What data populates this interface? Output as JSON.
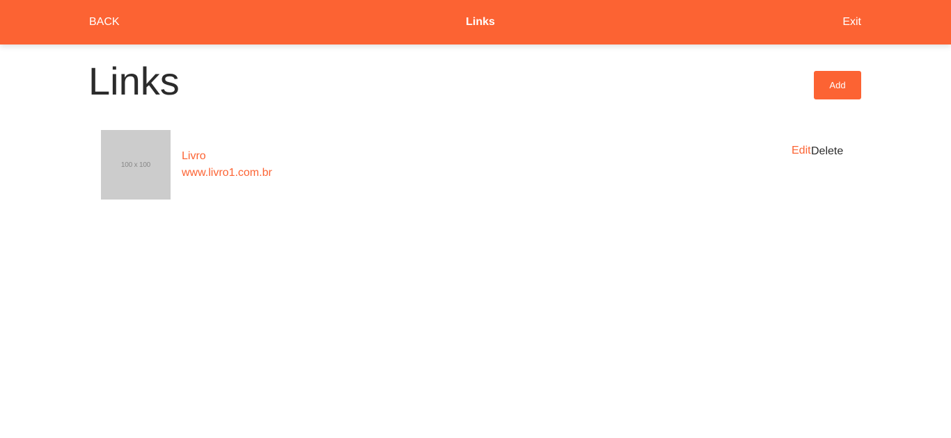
{
  "header": {
    "back_label": "BACK",
    "title": "Links",
    "exit_label": "Exit"
  },
  "main": {
    "title": "Links",
    "add_label": "Add",
    "links": [
      {
        "thumbnail_text": "100 x 100",
        "name": "Livro",
        "url": "www.livro1.com.br",
        "edit_label": "Edit",
        "delete_label": "Delete"
      }
    ]
  },
  "colors": {
    "accent": "#fc6333",
    "text": "#2b2b2b",
    "placeholder": "#cccccc"
  }
}
